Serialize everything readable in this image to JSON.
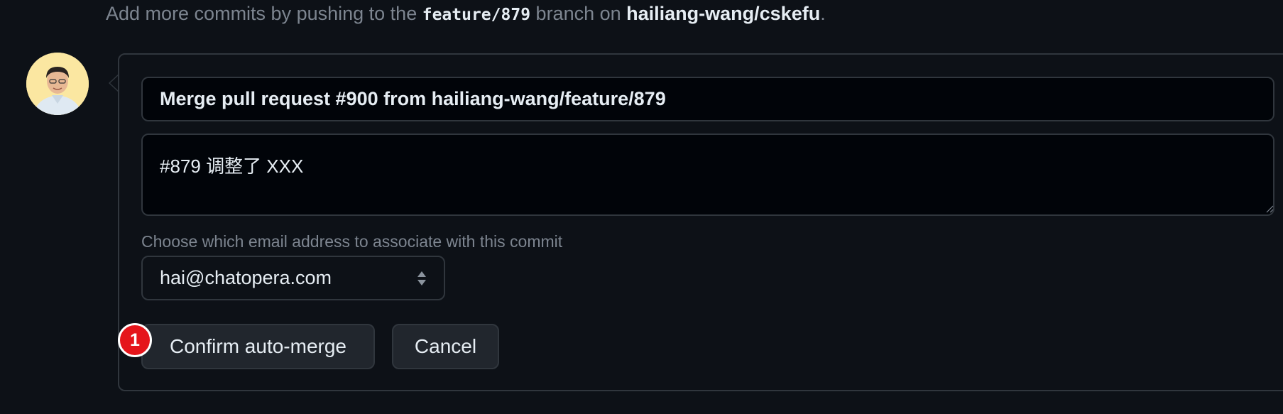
{
  "hint": {
    "prefix": "Add more commits by pushing to the ",
    "branch": "feature/879",
    "middle": " branch on ",
    "repo": "hailiang-wang/cskefu",
    "suffix": "."
  },
  "merge_form": {
    "title_value": "Merge pull request #900 from hailiang-wang/feature/879",
    "body_value": "#879 调整了 XXX",
    "email_label": "Choose which email address to associate with this commit",
    "email_selected": "hai@chatopera.com",
    "confirm_label": "Confirm auto-merge",
    "cancel_label": "Cancel"
  },
  "annotation": {
    "badge_number": "1"
  },
  "colors": {
    "background": "#0d1117",
    "border": "#30363d",
    "input_bg": "#010409",
    "muted_text": "#7d8590",
    "button_bg": "#21262d",
    "badge_red": "#e5151b"
  },
  "icons": [
    "avatar",
    "caret-pointer",
    "sort-arrows-icon",
    "resize-grip-icon"
  ]
}
